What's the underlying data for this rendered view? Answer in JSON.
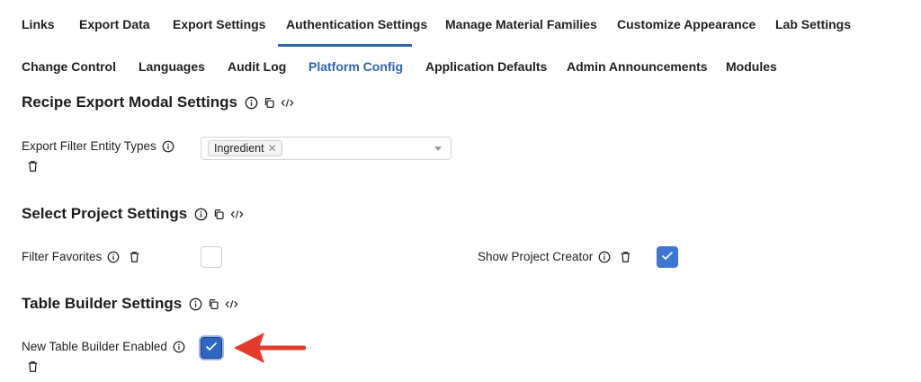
{
  "tabs_row1": [
    {
      "label": "Links"
    },
    {
      "label": "Export Data"
    },
    {
      "label": "Export Settings"
    },
    {
      "label": "Authentication Settings"
    },
    {
      "label": "Manage Material Families"
    },
    {
      "label": "Customize Appearance"
    },
    {
      "label": "Lab Settings"
    }
  ],
  "tabs_row2": [
    {
      "label": "Change Control"
    },
    {
      "label": "Languages"
    },
    {
      "label": "Audit Log"
    },
    {
      "label": "Platform Config"
    },
    {
      "label": "Application Defaults"
    },
    {
      "label": "Admin Announcements"
    },
    {
      "label": "Modules"
    }
  ],
  "sections": {
    "recipe_export": {
      "title": "Recipe Export Modal Settings",
      "fields": {
        "export_filter": {
          "label": "Export Filter Entity Types",
          "chip": "Ingredient",
          "chip_remove": "✕"
        }
      }
    },
    "select_project": {
      "title": "Select Project Settings",
      "fields": {
        "filter_favorites": {
          "label": "Filter Favorites",
          "checked": false
        },
        "show_project_creator": {
          "label": "Show Project Creator",
          "checked": true
        }
      }
    },
    "table_builder": {
      "title": "Table Builder Settings",
      "fields": {
        "new_table_builder": {
          "label": "New Table Builder Enabled",
          "checked": true
        }
      }
    }
  },
  "icons": {
    "info": "info-icon",
    "copy": "copy-icon",
    "code": "code-icon",
    "trash": "trash-icon",
    "check": "check-icon"
  },
  "colors": {
    "accent": "#2f66b0",
    "checkbox_checked": "#3d77d1",
    "annotation_arrow": "#e53b2c"
  }
}
